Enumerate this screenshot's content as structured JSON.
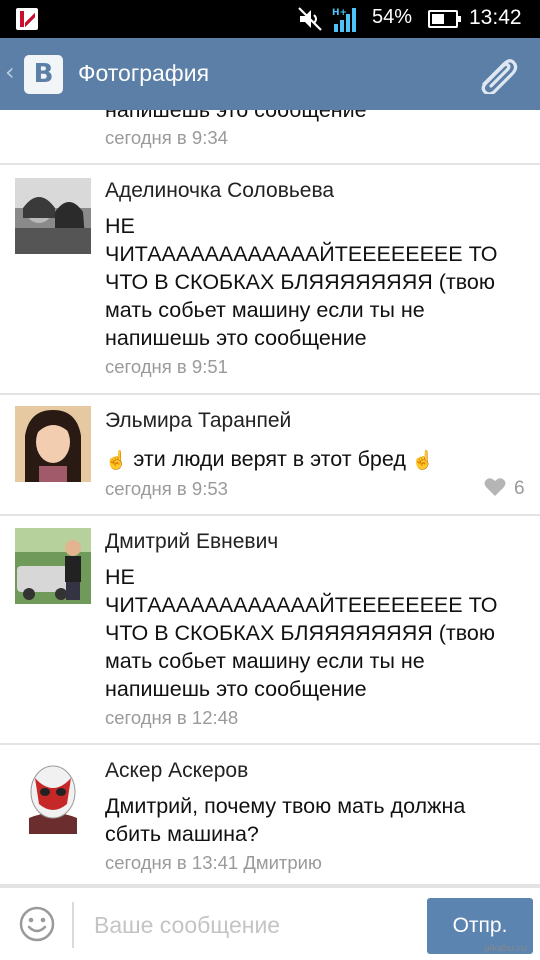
{
  "status_bar": {
    "battery_percent_label": "54%",
    "battery_level": 0.54,
    "network_label": "H+",
    "time": "13:42"
  },
  "header": {
    "back_glyph": "‹",
    "logo_letter": "В",
    "title": "Фотография",
    "attach_icon": "paperclip-icon"
  },
  "messages": [
    {
      "author": "",
      "lines": [
        "напишешь это сообщение"
      ],
      "time": "сегодня в 9:34",
      "likes": ""
    },
    {
      "author": "Аделиночка Соловьева",
      "lines": [
        "НЕ",
        "ЧИТААААААААААААЙТЕЕЕЕЕЕЕЕ ТО",
        "ЧТО В СКОБКАХ БЛЯЯЯЯЯЯЯЯ (твою",
        "мать собьет машину если ты не",
        "напишешь это сообщение"
      ],
      "time": "сегодня в 9:51",
      "likes": ""
    },
    {
      "author": "Эльмира Таранпей",
      "lines": [
        "эти люди верят в этот бред"
      ],
      "time": "сегодня в 9:53",
      "likes": "6"
    },
    {
      "author": "Дмитрий Евневич",
      "lines": [
        "НЕ",
        "ЧИТААААААААААААЙТЕЕЕЕЕЕЕЕ ТО",
        "ЧТО В СКОБКАХ БЛЯЯЯЯЯЯЯЯ (твою",
        "мать собьет машину если ты не",
        "напишешь это сообщение"
      ],
      "time": "сегодня в 12:48",
      "likes": ""
    },
    {
      "author": "Аскер Аскеров",
      "lines": [
        "Дмитрий, почему твою мать должна",
        "сбить машина?"
      ],
      "time": "сегодня в 13:41 Дмитрию",
      "likes": ""
    }
  ],
  "composer": {
    "placeholder": "Ваше сообщение",
    "value": "",
    "send_label": "Отпр."
  },
  "watermark": "pikabu.ru",
  "colors": {
    "header_bg": "#5b7fa6",
    "send_button_bg": "#5b84b1",
    "timestamp_text": "#9a9a9a"
  }
}
